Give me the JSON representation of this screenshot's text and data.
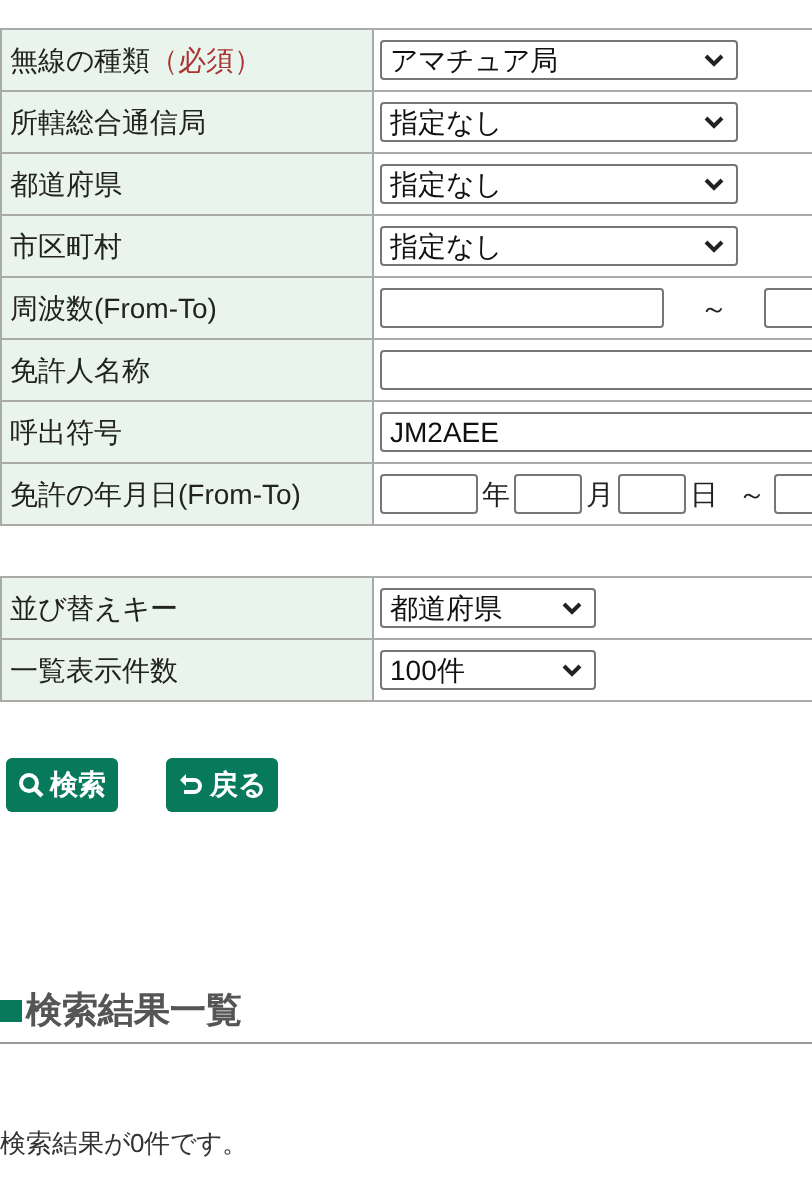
{
  "search_form": {
    "rows": [
      {
        "label": "無線の種類",
        "required_note": "（必須）",
        "kind": "select",
        "value": "アマチュア局"
      },
      {
        "label": "所轄総合通信局",
        "kind": "select",
        "value": "指定なし"
      },
      {
        "label": "都道府県",
        "kind": "select",
        "value": "指定なし"
      },
      {
        "label": "市区町村",
        "kind": "select",
        "value": "指定なし"
      },
      {
        "label": "周波数(From-To)",
        "kind": "range",
        "separator": "～"
      },
      {
        "label": "免許人名称",
        "kind": "text"
      },
      {
        "label": "呼出符号",
        "kind": "text",
        "value": "JM2AEE"
      },
      {
        "label": "免許の年月日(From-To)",
        "kind": "date",
        "units": [
          "年",
          "月",
          "日"
        ],
        "separator": "～"
      }
    ]
  },
  "display_options": {
    "rows": [
      {
        "label": "並び替えキー",
        "kind": "select",
        "value": "都道府県"
      },
      {
        "label": "一覧表示件数",
        "kind": "select",
        "value": "100件"
      }
    ]
  },
  "buttons": [
    {
      "label": "検索",
      "kind": "search"
    },
    {
      "label": "戻る",
      "kind": "back"
    }
  ],
  "results": {
    "heading": "検索結果一覧",
    "message": "検索結果が0件です。"
  }
}
